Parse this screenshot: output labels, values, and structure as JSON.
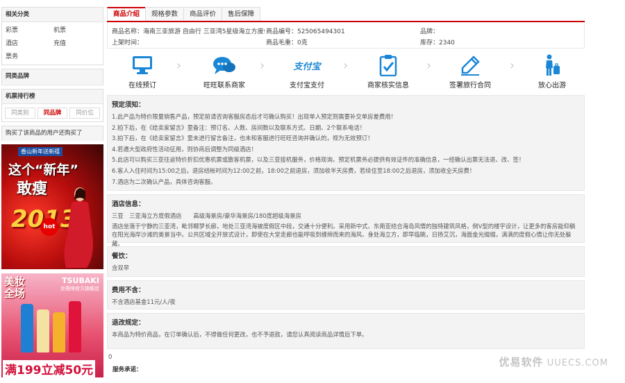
{
  "sidebar": {
    "related_title": "相关分类",
    "categories": [
      "彩票",
      "机票",
      "酒店",
      "充值",
      "票务"
    ],
    "brand_title": "同类品牌",
    "rank_title": "机票排行榜",
    "rank_tabs": [
      "同类别",
      "同品牌",
      "同价位"
    ],
    "also_bought": "购买了该商品的用户还购买了"
  },
  "ads": {
    "ad1_top": "香山新年送新禧",
    "ad1_line1": "这个“新年”",
    "ad1_line2": "敢瘦",
    "ad1_year": "2013",
    "ad1_hot": "hot",
    "ad2_brand": "TSUBAKI",
    "ad2_sub": "丝蓓绮官方旗舰店",
    "ad2_title_1": "美妆",
    "ad2_title_2": "全场",
    "ad2_price": "满199立减50元"
  },
  "tabs": [
    "商品介绍",
    "规格参数",
    "商品评价",
    "售后保障"
  ],
  "info": {
    "name": "商品名称：海南三亚旅游 自由行 三亚湾5星级海立方度假...",
    "code": "商品编号：525065494301",
    "brand": "品牌：",
    "listed": "上架时间：",
    "weight": "商品毛重：0克",
    "stock": "库存：2340"
  },
  "steps": [
    "在线预订",
    "旺旺联系商家",
    "支付宝支付",
    "商家核实信息",
    "签署旅行合同",
    "放心出游"
  ],
  "alipay_logo": "支付宝",
  "notice": {
    "title": "预定须知：",
    "lines": [
      "1.此产品为特价限量销售产品，预定前请咨询客服房态后才可确认购买！出现单人预定则需要补交单房差费用！",
      "2.拍下后，在《给卖家留言》里备注：预订名、人数、房间数以及联系方式、日期、2个联系电话！",
      "3.拍下后，在《给卖家留言》里未进行留言备注，也未和客服进行旺旺咨询并确认的，视为无效预订！",
      "4.若遇大型政府性活动征用，则协商后调整为同级酒店！",
      "5.此店可以购买三亚往返特价折扣优惠机票或散客机票，以及三亚接机服务，价格现询。预定机票务必提供有效证件的准确信息，一经确认出票无法退、改、签！",
      "6.客人入住时间为15:00之后，退房结帐时间为12:00之前，18:00之前退房，须加收半天房费，若续住至18:00之后退房，须加收全天房费！",
      "7.酒店为二次确认产品，具体咨询客服。"
    ]
  },
  "hotel": {
    "title": "酒店信息：",
    "line1": "三亚　三亚海立方度假酒店　　高级海景房/豪华海景房/180度超级海景房",
    "desc": "酒店坐落于宁静的三亚湾，毗邻椰梦长廊，地处三亚湾海被度假区中段，交通十分便利。采用新中式、东南亚结合海岛风情的独特建筑风格，倒V型的楼宇设计，让更多的客房能仰躺在阳光海岸沙滩的美景当中。公共区域全开放式设计，即使在大堂走廊也能呼吸到缠绵而来的海风。身处海立方，即早临眺，日扬艾沉，海面金光缀缀，满满的度假心情让你无处躲藏。"
  },
  "meal": {
    "title": "餐饮：",
    "text": "含双早"
  },
  "excluded": {
    "title": "费用不含：",
    "text": "不含酒店基金11元/人/夜"
  },
  "refund": {
    "title": "退改规定：",
    "text": "本商品为特价商品，在订单确认后，不得做任何更改，也不予退款，请您认真阅读商品详情后下单。"
  },
  "misc_zero": "0",
  "service_label": "服务承诺：",
  "watermark": {
    "brand": "优易软件",
    "domain": "UUECS.COM"
  },
  "colors": {
    "accent": "#cc0000",
    "icon_blue": "#1a86d6",
    "panel_bg": "#f3f3f3"
  },
  "icons": [
    "monitor-icon",
    "chat-bubbles-icon",
    "alipay-logo",
    "clipboard-check-icon",
    "pen-icon",
    "traveler-suitcase-icon"
  ]
}
